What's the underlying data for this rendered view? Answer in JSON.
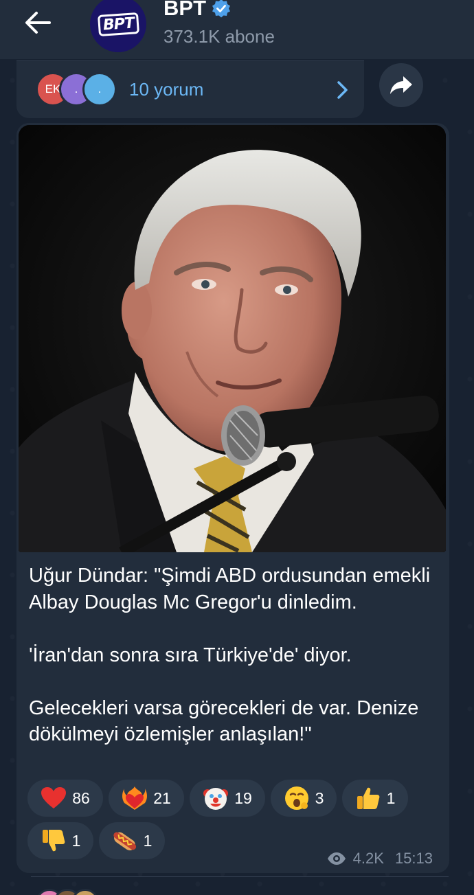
{
  "channel": {
    "name": "BPT",
    "avatar_text": "BPT",
    "subscribers": "373.1K abone"
  },
  "previous_post": {
    "commenter_avatars": [
      "EK",
      ".",
      "."
    ],
    "comments_label": "10 yorum"
  },
  "post": {
    "photo_alt": "Uğur Dündar portrait at microphone",
    "caption": "Uğur Dündar: \"Şimdi ABD ordusundan emekli Albay Douglas Mc Gregor'u dinledim.\n\n'İran'dan sonra sıra Türkiye'de' diyor.\n\nGelecekleri varsa görecekleri de var. Denize dökülmeyi özlemişler anlaşılan!\"",
    "reactions": [
      {
        "icon": "heart-icon",
        "count": "86"
      },
      {
        "icon": "heart-on-fire-icon",
        "count": "21"
      },
      {
        "icon": "clown-face-icon",
        "count": "19"
      },
      {
        "icon": "yawning-face-icon",
        "count": "3"
      },
      {
        "icon": "thumbs-up-icon",
        "count": "1"
      },
      {
        "icon": "thumbs-down-icon",
        "count": "1"
      },
      {
        "icon": "hot-dog-icon",
        "count": "1"
      }
    ],
    "views": "4.2K",
    "time": "15:13"
  },
  "colors": {
    "accent_link": "#6cb8f6",
    "bubble": "#222d3c",
    "background": "#182231"
  }
}
